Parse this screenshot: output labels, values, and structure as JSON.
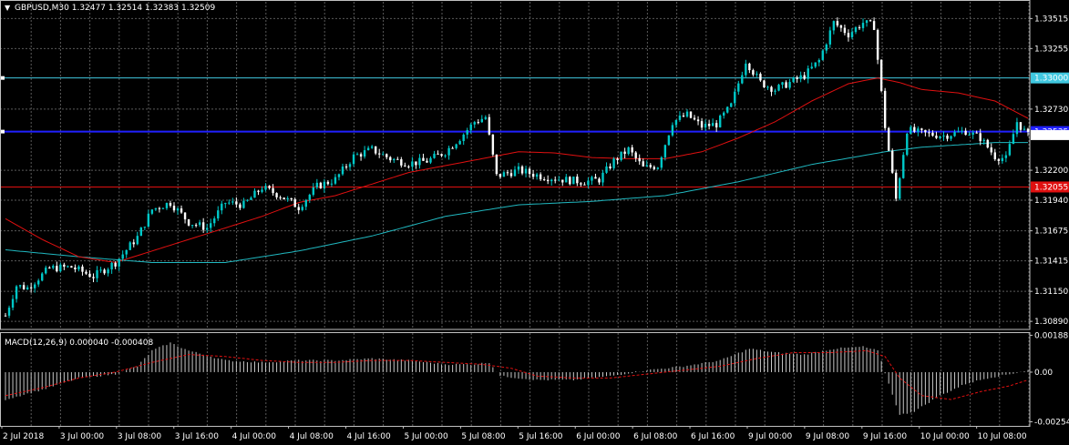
{
  "window": {
    "symbol_line": "GBPUSD,M30  1.32477 1.32514 1.32383 1.32509",
    "indicator_line": "MACD(12,26,9) 0.000040 -0.000408"
  },
  "colors": {
    "background": "#000000",
    "grid": "#5a5a5a",
    "candle_up": "#00c8c8",
    "candle_down": "#ffffff",
    "ma_fast": "#e01010",
    "ma_slow": "#20b8c0",
    "line_cyan": "#40c8e0",
    "line_blue": "#2020ff",
    "line_red": "#e01010",
    "macd_hist": "#c8c8c8",
    "macd_signal": "#e01010"
  },
  "chart_data": [
    {
      "type": "candlestick",
      "title": "GBPUSD,M30  1.32477 1.32514 1.32383 1.32509",
      "ylim": [
        1.3082,
        1.3366
      ],
      "y_ticks": [
        "1.33515",
        "1.33255",
        "1.32730",
        "1.32200",
        "1.31940",
        "1.31675",
        "1.31415",
        "1.31150",
        "1.30890"
      ],
      "x_ticks": [
        "2 Jul 2018",
        "3 Jul 00:00",
        "3 Jul 08:00",
        "3 Jul 16:00",
        "4 Jul 00:00",
        "4 Jul 08:00",
        "4 Jul 16:00",
        "5 Jul 00:00",
        "5 Jul 08:00",
        "5 Jul 16:00",
        "6 Jul 00:00",
        "6 Jul 08:00",
        "6 Jul 16:00",
        "9 Jul 00:00",
        "9 Jul 08:00",
        "9 Jul 16:00",
        "10 Jul 00:00",
        "10 Jul 08:00"
      ],
      "horizontal_lines": [
        {
          "price": 1.33,
          "label": "1.33000",
          "color": "#40c8e0"
        },
        {
          "price": 1.32535,
          "label": "1.32535",
          "color": "#2020ff"
        },
        {
          "price": 1.32055,
          "label": "1.32055",
          "color": "#e01010"
        }
      ],
      "current_price_label": "1.32509",
      "close_anchors": [
        [
          0,
          1.3094
        ],
        [
          3,
          1.312
        ],
        [
          6,
          1.3118
        ],
        [
          12,
          1.3135
        ],
        [
          18,
          1.3136
        ],
        [
          24,
          1.3128
        ],
        [
          30,
          1.314
        ],
        [
          36,
          1.3162
        ],
        [
          40,
          1.3186
        ],
        [
          45,
          1.3192
        ],
        [
          50,
          1.3175
        ],
        [
          55,
          1.317
        ],
        [
          60,
          1.3192
        ],
        [
          65,
          1.319
        ],
        [
          70,
          1.3205
        ],
        [
          75,
          1.3198
        ],
        [
          80,
          1.3188
        ],
        [
          85,
          1.3206
        ],
        [
          90,
          1.3212
        ],
        [
          95,
          1.3232
        ],
        [
          100,
          1.3238
        ],
        [
          105,
          1.323
        ],
        [
          110,
          1.3226
        ],
        [
          115,
          1.3228
        ],
        [
          120,
          1.3236
        ],
        [
          124,
          1.3248
        ],
        [
          128,
          1.3262
        ],
        [
          131,
          1.3266
        ],
        [
          134,
          1.3215
        ],
        [
          140,
          1.322
        ],
        [
          146,
          1.3215
        ],
        [
          152,
          1.3212
        ],
        [
          158,
          1.321
        ],
        [
          162,
          1.3212
        ],
        [
          166,
          1.3228
        ],
        [
          170,
          1.3238
        ],
        [
          174,
          1.3222
        ],
        [
          178,
          1.3224
        ],
        [
          182,
          1.3262
        ],
        [
          186,
          1.3268
        ],
        [
          190,
          1.3258
        ],
        [
          194,
          1.326
        ],
        [
          198,
          1.3276
        ],
        [
          202,
          1.3315
        ],
        [
          206,
          1.3296
        ],
        [
          210,
          1.329
        ],
        [
          214,
          1.3296
        ],
        [
          218,
          1.3302
        ],
        [
          222,
          1.3315
        ],
        [
          226,
          1.3348
        ],
        [
          230,
          1.3338
        ],
        [
          234,
          1.3348
        ],
        [
          237,
          1.3345
        ],
        [
          240,
          1.3258
        ],
        [
          243,
          1.3195
        ],
        [
          246,
          1.3255
        ],
        [
          250,
          1.3252
        ],
        [
          256,
          1.325
        ],
        [
          262,
          1.3254
        ],
        [
          266,
          1.3248
        ],
        [
          270,
          1.3232
        ],
        [
          273,
          1.323
        ],
        [
          276,
          1.3262
        ],
        [
          279,
          1.325
        ]
      ],
      "ma_fast_anchors": [
        [
          0,
          1.3178
        ],
        [
          10,
          1.316
        ],
        [
          20,
          1.3145
        ],
        [
          30,
          1.314
        ],
        [
          40,
          1.315
        ],
        [
          50,
          1.316
        ],
        [
          60,
          1.317
        ],
        [
          70,
          1.318
        ],
        [
          80,
          1.3192
        ],
        [
          90,
          1.3198
        ],
        [
          100,
          1.3208
        ],
        [
          110,
          1.3218
        ],
        [
          120,
          1.3224
        ],
        [
          130,
          1.323
        ],
        [
          140,
          1.3236
        ],
        [
          150,
          1.3235
        ],
        [
          160,
          1.3231
        ],
        [
          170,
          1.323
        ],
        [
          180,
          1.323
        ],
        [
          190,
          1.3236
        ],
        [
          200,
          1.3248
        ],
        [
          210,
          1.3262
        ],
        [
          220,
          1.328
        ],
        [
          230,
          1.3295
        ],
        [
          238,
          1.33
        ],
        [
          244,
          1.3296
        ],
        [
          250,
          1.329
        ],
        [
          260,
          1.3287
        ],
        [
          270,
          1.328
        ],
        [
          279,
          1.3265
        ]
      ],
      "ma_slow_anchors": [
        [
          0,
          1.3151
        ],
        [
          20,
          1.3145
        ],
        [
          40,
          1.314
        ],
        [
          60,
          1.314
        ],
        [
          80,
          1.315
        ],
        [
          100,
          1.3163
        ],
        [
          120,
          1.318
        ],
        [
          140,
          1.319
        ],
        [
          160,
          1.3193
        ],
        [
          180,
          1.3198
        ],
        [
          200,
          1.321
        ],
        [
          220,
          1.3225
        ],
        [
          240,
          1.3236
        ],
        [
          250,
          1.324
        ],
        [
          260,
          1.3242
        ],
        [
          270,
          1.3244
        ],
        [
          279,
          1.3244
        ]
      ]
    },
    {
      "type": "bar",
      "title": "MACD(12,26,9) 0.000040 -0.000408",
      "ylim": [
        -0.00275,
        0.002
      ],
      "y_ticks": [
        "0.001887",
        "0.00",
        "-0.002541"
      ],
      "hist_anchors": [
        [
          0,
          -0.0014
        ],
        [
          10,
          -0.0009
        ],
        [
          20,
          -0.0003
        ],
        [
          30,
          -0.0001
        ],
        [
          36,
          0.0003
        ],
        [
          40,
          0.0011
        ],
        [
          45,
          0.0015
        ],
        [
          50,
          0.0011
        ],
        [
          60,
          0.0006
        ],
        [
          70,
          0.0005
        ],
        [
          80,
          0.0006
        ],
        [
          90,
          0.0006
        ],
        [
          100,
          0.0007
        ],
        [
          110,
          0.0006
        ],
        [
          120,
          0.0004
        ],
        [
          128,
          0.0004
        ],
        [
          132,
          0.0005
        ],
        [
          135,
          -0.0002
        ],
        [
          145,
          -0.0004
        ],
        [
          155,
          -0.0004
        ],
        [
          165,
          -0.0002
        ],
        [
          175,
          0.0001
        ],
        [
          185,
          0.0003
        ],
        [
          195,
          0.0006
        ],
        [
          203,
          0.0012
        ],
        [
          210,
          0.001
        ],
        [
          218,
          0.0009
        ],
        [
          226,
          0.0012
        ],
        [
          234,
          0.0013
        ],
        [
          238,
          0.0011
        ],
        [
          241,
          -0.0006
        ],
        [
          244,
          -0.0022
        ],
        [
          248,
          -0.002
        ],
        [
          255,
          -0.0012
        ],
        [
          262,
          -0.0006
        ],
        [
          268,
          -0.0003
        ],
        [
          274,
          -0.0001
        ],
        [
          279,
          0.0001
        ]
      ],
      "signal_anchors": [
        [
          0,
          -0.0012
        ],
        [
          10,
          -0.0008
        ],
        [
          20,
          -0.0003
        ],
        [
          30,
          0.0
        ],
        [
          40,
          0.0005
        ],
        [
          50,
          0.0009
        ],
        [
          60,
          0.0008
        ],
        [
          70,
          0.0006
        ],
        [
          80,
          0.0005
        ],
        [
          90,
          0.0005
        ],
        [
          100,
          0.0006
        ],
        [
          110,
          0.0006
        ],
        [
          120,
          0.0005
        ],
        [
          130,
          0.0004
        ],
        [
          138,
          0.0002
        ],
        [
          145,
          -0.0002
        ],
        [
          155,
          -0.0003
        ],
        [
          165,
          -0.0003
        ],
        [
          175,
          -0.0001
        ],
        [
          185,
          0.0001
        ],
        [
          195,
          0.0003
        ],
        [
          205,
          0.0007
        ],
        [
          215,
          0.001
        ],
        [
          225,
          0.001
        ],
        [
          235,
          0.0011
        ],
        [
          240,
          0.0008
        ],
        [
          244,
          -0.0003
        ],
        [
          250,
          -0.0012
        ],
        [
          258,
          -0.0014
        ],
        [
          266,
          -0.001
        ],
        [
          274,
          -0.0007
        ],
        [
          279,
          -0.0004
        ]
      ]
    }
  ]
}
